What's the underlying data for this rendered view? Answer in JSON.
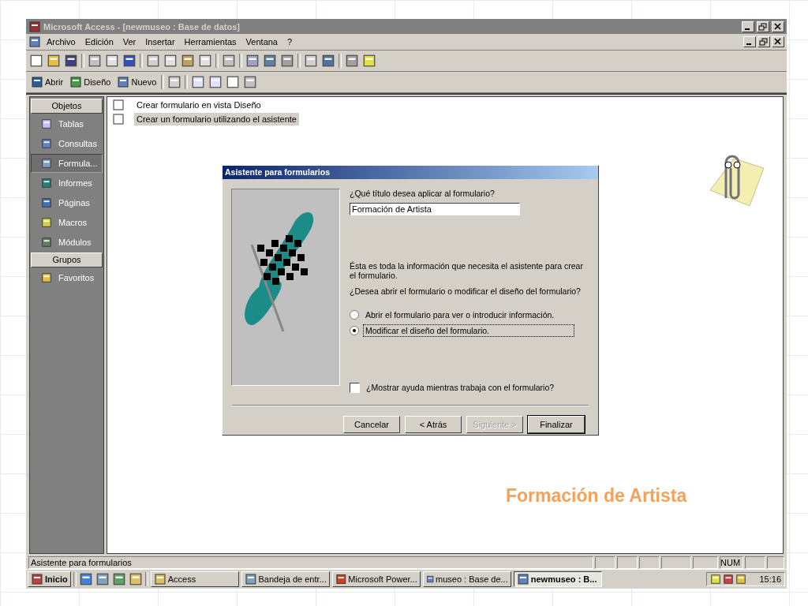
{
  "window": {
    "title": "Microsoft Access - [newmuseo : Base de datos]"
  },
  "menu": [
    {
      "label": "Archivo"
    },
    {
      "label": "Edición"
    },
    {
      "label": "Ver"
    },
    {
      "label": "Insertar"
    },
    {
      "label": "Herramientas"
    },
    {
      "label": "Ventana"
    },
    {
      "label": "?"
    }
  ],
  "db_toolbar": [
    {
      "label": "Abrir"
    },
    {
      "label": "Diseño"
    },
    {
      "label": "Nuevo"
    }
  ],
  "sidebar": {
    "objects_header": "Objetos",
    "items": [
      {
        "label": "Tablas",
        "selected": false
      },
      {
        "label": "Consultas",
        "selected": false
      },
      {
        "label": "Formula...",
        "selected": true
      },
      {
        "label": "Informes",
        "selected": false
      },
      {
        "label": "Páginas",
        "selected": false
      },
      {
        "label": "Macros",
        "selected": false
      },
      {
        "label": "Módulos",
        "selected": false
      }
    ],
    "groups_header": "Grupos",
    "groups": [
      {
        "label": "Favoritos"
      }
    ]
  },
  "list": [
    {
      "label": "Crear formulario en vista Diseño",
      "selected": false
    },
    {
      "label": "Crear un formulario utilizando el asistente",
      "selected": true
    }
  ],
  "dialog": {
    "title": "Asistente para formularios",
    "question": "¿Qué título desea aplicar al formulario?",
    "title_value": "Formación de Artista",
    "info": "Ésta es toda la información que necesita el asistente para crear el formulario.",
    "question2": "¿Desea abrir el formulario o modificar el diseño del formulario?",
    "options": [
      {
        "label": "Abrir el formulario para ver o introducir información.",
        "selected": false
      },
      {
        "label": "Modificar el diseño del formulario.",
        "selected": true
      }
    ],
    "help": {
      "label": "¿Mostrar ayuda mientras trabaja con el formulario?",
      "checked": false
    },
    "buttons": [
      {
        "label": "Cancelar",
        "disabled": false,
        "default": false
      },
      {
        "label": "< Atrás",
        "disabled": false,
        "default": false
      },
      {
        "label": "Siguiente >",
        "disabled": true,
        "default": false
      },
      {
        "label": "Finalizar",
        "disabled": false,
        "default": true
      }
    ]
  },
  "caption": "Formación de Artista",
  "status_bar": {
    "text": "Asistente para formularios",
    "num": "NUM"
  },
  "taskbar": {
    "start": "Inicio",
    "tasks": [
      {
        "label": "Access",
        "selected": false
      },
      {
        "label": "Bandeja de entr...",
        "selected": false
      },
      {
        "label": "Microsoft Power...",
        "selected": false
      },
      {
        "label": "museo : Base de...",
        "selected": false
      },
      {
        "label": "newmuseo : B...",
        "selected": true
      }
    ],
    "clock": "15:16"
  }
}
